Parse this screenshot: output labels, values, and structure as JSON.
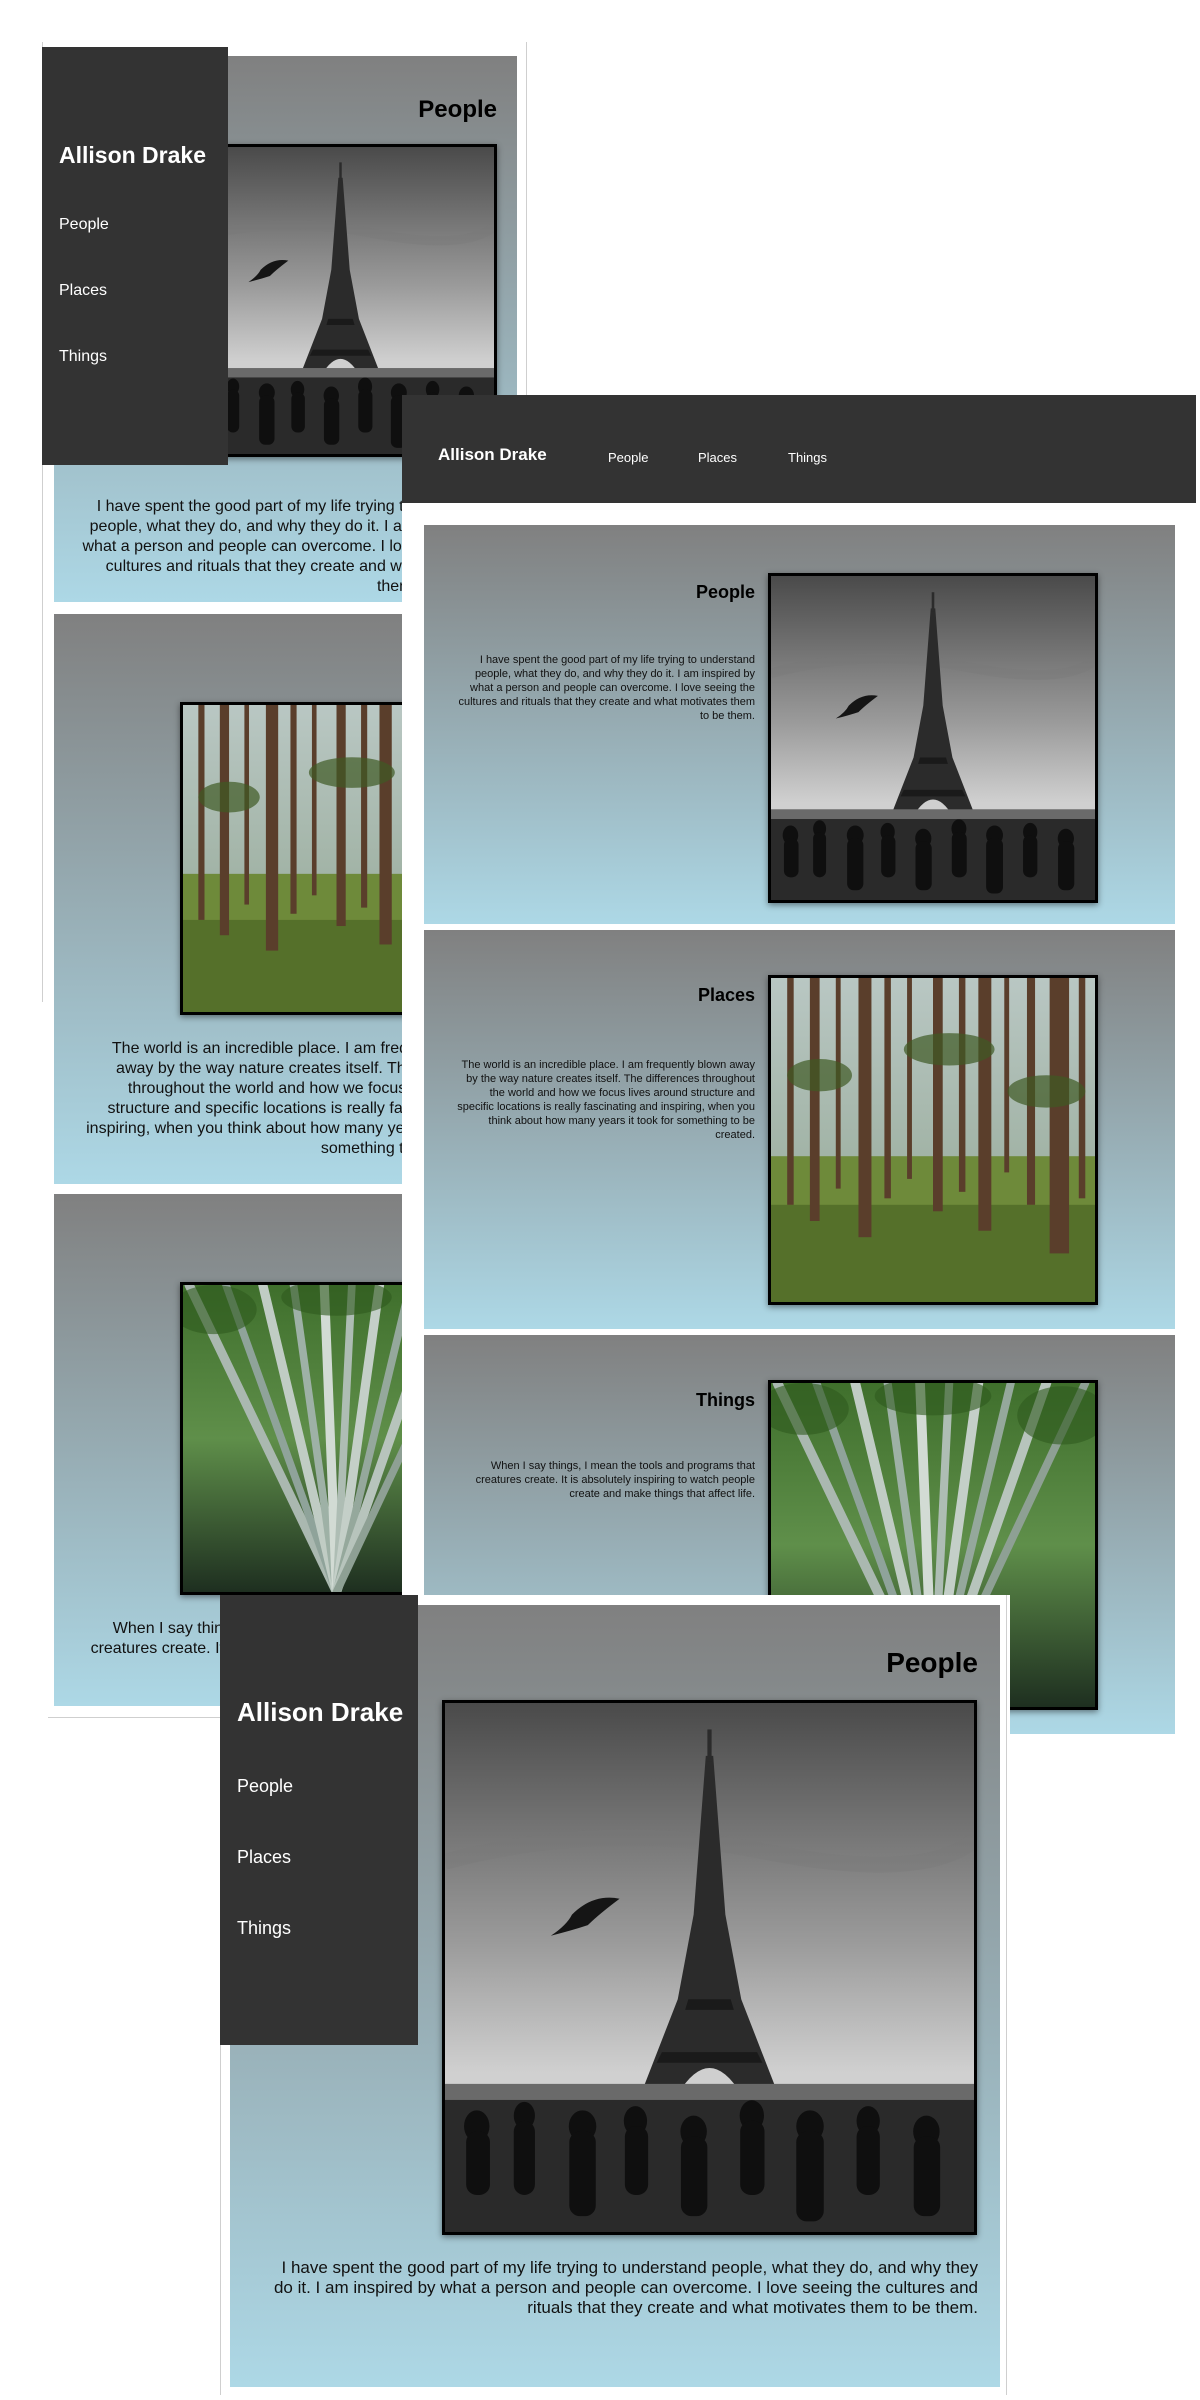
{
  "site": {
    "brand": "Allison Drake",
    "nav": [
      "People",
      "Places",
      "Things"
    ]
  },
  "sections": {
    "people": {
      "title": "People",
      "text": "I have spent the good part of my life trying to understand people, what they do, and why they do it. I am inspired by what a person and people can overcome. I love seeing the cultures and rituals that they create and what motivates them to be them."
    },
    "places": {
      "title": "Places",
      "text": "The world is an incredible place. I am frequently blown away by the way nature creates itself. The differences throughout the world and how we focus lives around structure and specific locations is really fascinating and inspiring, when you think about how many years it took for something to be created."
    },
    "things": {
      "title": "Things",
      "text": "When I say things, I mean the tools and programs that creatures create. It is absolutely inspiring to watch people create and make things that affect life."
    }
  },
  "icons": {
    "people_photo": "eiffel-tower-photo",
    "places_photo": "pine-forest-photo",
    "things_photo": "bamboo-forest-photo"
  },
  "colors": {
    "nav_background": "#333333",
    "panel_gradient_top": "#808080",
    "panel_gradient_bottom": "#add8e6",
    "text_light": "#ffffff",
    "text_dark": "#000000"
  }
}
